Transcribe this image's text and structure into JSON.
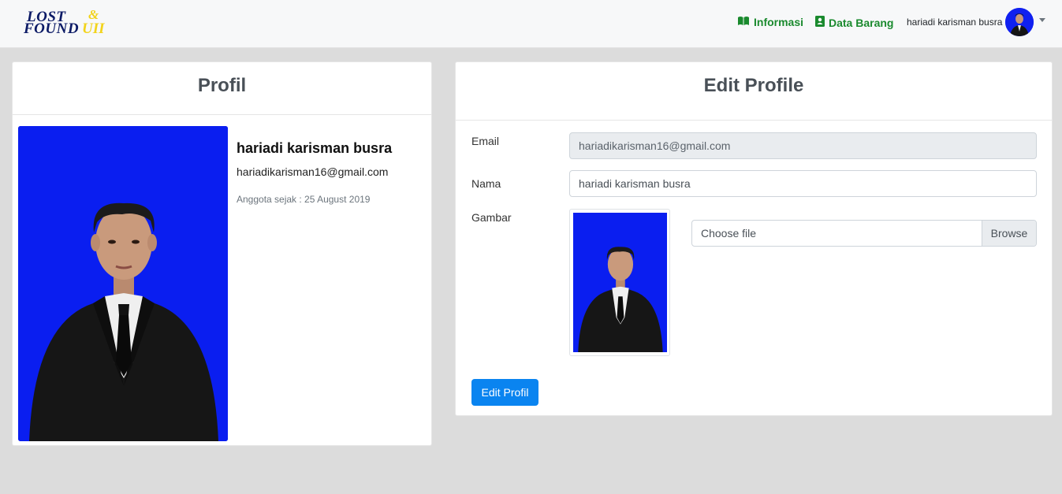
{
  "brand": {
    "line1": "LOST",
    "amp": "&",
    "line2": "FOUND",
    "suffix": "UII",
    "colors": {
      "navy": "#0b1a66",
      "yellow": "#f2d31b"
    }
  },
  "nav": {
    "links": [
      {
        "label": "Informasi",
        "icon": "book-icon"
      },
      {
        "label": "Data Barang",
        "icon": "contact-book-icon"
      }
    ],
    "user_name": "hariadi karisman busra",
    "link_color": "#1a8a2e"
  },
  "profile_card": {
    "title": "Profil",
    "name": "hariadi karisman busra",
    "email": "hariadikarisman16@gmail.com",
    "member_since": "Anggota sejak : 25 August 2019",
    "photo_bg": "#0a1ef0"
  },
  "edit_card": {
    "title": "Edit Profile",
    "email_label": "Email",
    "email_value": "hariadikarisman16@gmail.com",
    "name_label": "Nama",
    "name_value": "hariadi karisman busra",
    "image_label": "Gambar",
    "file_placeholder": "Choose file",
    "browse_label": "Browse",
    "submit_label": "Edit Profil",
    "button_color": "#0a84f0"
  }
}
